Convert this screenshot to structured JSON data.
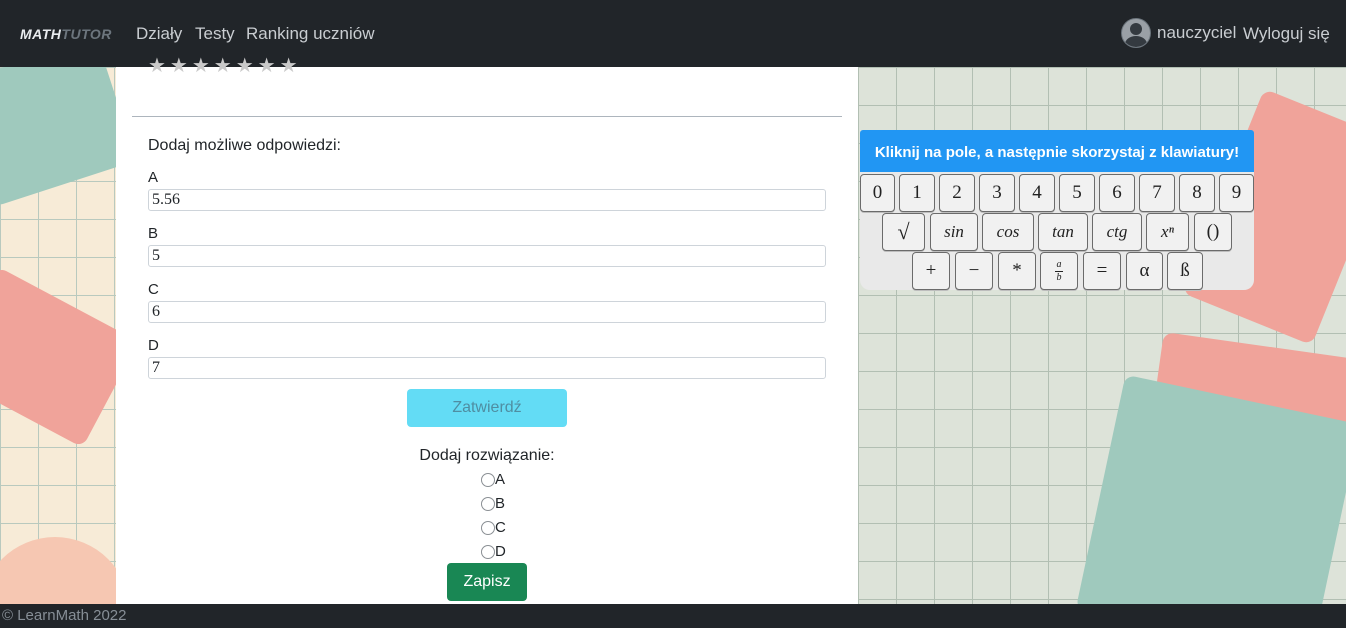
{
  "navbar": {
    "brand_part1": "MATH",
    "brand_part2": "TUTOR",
    "links": [
      "Działy",
      "Testy",
      "Ranking uczniów"
    ],
    "username": "nauczyciel",
    "logout": "Wyloguj się"
  },
  "form": {
    "rating_stars": "★★★★★★★",
    "answers_title": "Dodaj możliwe odpowiedzi:",
    "options": [
      {
        "label": "A",
        "value": "5.56"
      },
      {
        "label": "B",
        "value": "5"
      },
      {
        "label": "C",
        "value": "6"
      },
      {
        "label": "D",
        "value": "7"
      }
    ],
    "confirm_button": "Zatwierdź",
    "solution_title": "Dodaj rozwiązanie:",
    "radio_options": [
      "A",
      "B",
      "C",
      "D"
    ],
    "save_button": "Zapisz"
  },
  "keyboard": {
    "title": "Kliknij na pole, a następnie skorzystaj z klawiatury!",
    "row1": [
      "0",
      "1",
      "2",
      "3",
      "4",
      "5",
      "6",
      "7",
      "8",
      "9"
    ],
    "row2": [
      "√",
      "sin",
      "cos",
      "tan",
      "ctg",
      "xⁿ",
      "()"
    ],
    "row3": [
      "+",
      "−",
      "*",
      "a/b",
      "=",
      "α",
      "ß"
    ]
  },
  "footer": {
    "text": "© LearnMath 2022"
  },
  "colors": {
    "navbar": "#212529",
    "keyboard_header": "#2196f3",
    "confirm_button": "#63dcf5",
    "save_button": "#198754"
  }
}
